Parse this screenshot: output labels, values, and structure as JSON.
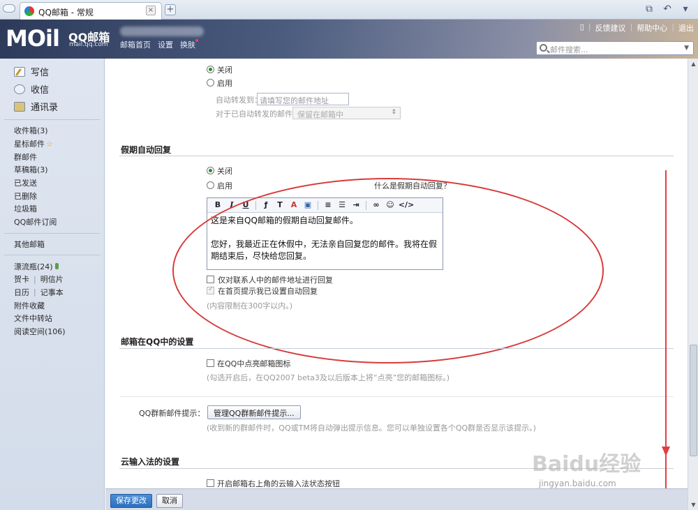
{
  "browser": {
    "tab_title": "QQ邮箱 - 常规",
    "tab_close": "×",
    "new_tab": "+"
  },
  "header": {
    "logo_main": "MOil",
    "logo_sub1": "QQ邮箱",
    "logo_sub2": "mail.qq.com",
    "nav": [
      "邮箱首页",
      "设置",
      "换肤"
    ],
    "links": [
      "反馈建议",
      "帮助中心",
      "退出"
    ],
    "search_placeholder": "邮件搜索..."
  },
  "sidebar": {
    "main": [
      "写信",
      "收信",
      "通讯录"
    ],
    "folders": [
      "收件箱(3)",
      "星标邮件",
      "群邮件",
      "草稿箱(3)",
      "已发送",
      "已删除",
      "垃圾箱",
      "QQ邮件订阅"
    ],
    "other": "其他邮箱",
    "extras": {
      "drift": "漂流瓶(24)",
      "card": "贺卡",
      "postcard": "明信片",
      "calendar": "日历",
      "notebook": "记事本",
      "attachments": "附件收藏",
      "transfer": "文件中转站",
      "reading": "阅读空间(106)"
    }
  },
  "forward": {
    "off": "关闭",
    "on": "启用",
    "to_label": "自动转发到：",
    "to_placeholder": "请填写您的邮件地址",
    "after_label": "对于已自动转发的邮件：",
    "after_value": "保留在邮箱中"
  },
  "vacation": {
    "title": "假期自动回复",
    "off": "关闭",
    "on": "启用",
    "help": "什么是假期自动回复？",
    "toolbar": [
      "B",
      "I",
      "U"
    ],
    "body_line1": "这是来自QQ邮箱的假期自动回复邮件。",
    "body_line2": "您好，我最近正在休假中，无法亲自回复您的邮件。我将在假期结束后，尽快给您回复。",
    "only_contacts": "仅对联系人中的邮件地址进行回复",
    "show_home": "在首页提示我已设置自动回复",
    "limit": "(内容限制在300字以内。)"
  },
  "qq_settings": {
    "title": "邮箱在QQ中的设置",
    "light_icon": "在QQ中点亮邮箱图标",
    "light_hint": "(勾选开启后，在QQ2007 beta3及以后版本上将“点亮”您的邮箱图标。)",
    "group_label": "QQ群新邮件提示：",
    "group_button": "管理QQ群新邮件提示...",
    "group_hint": "(收到新的群邮件时，QQ或TM将自动弹出提示信息。您可以单独设置各个QQ群是否显示该提示。)"
  },
  "cloud_ime": {
    "title": "云输入法的设置",
    "toggle": "开启邮箱右上角的云输入法状态按钮"
  },
  "actions": {
    "save": "保存更改",
    "cancel": "取消"
  },
  "watermark": {
    "main": "Baidu经验",
    "sub": "jingyan.baidu.com"
  },
  "colors": {
    "annotation_red": "#d83a3a",
    "primary_button": "#2b6fbf"
  }
}
